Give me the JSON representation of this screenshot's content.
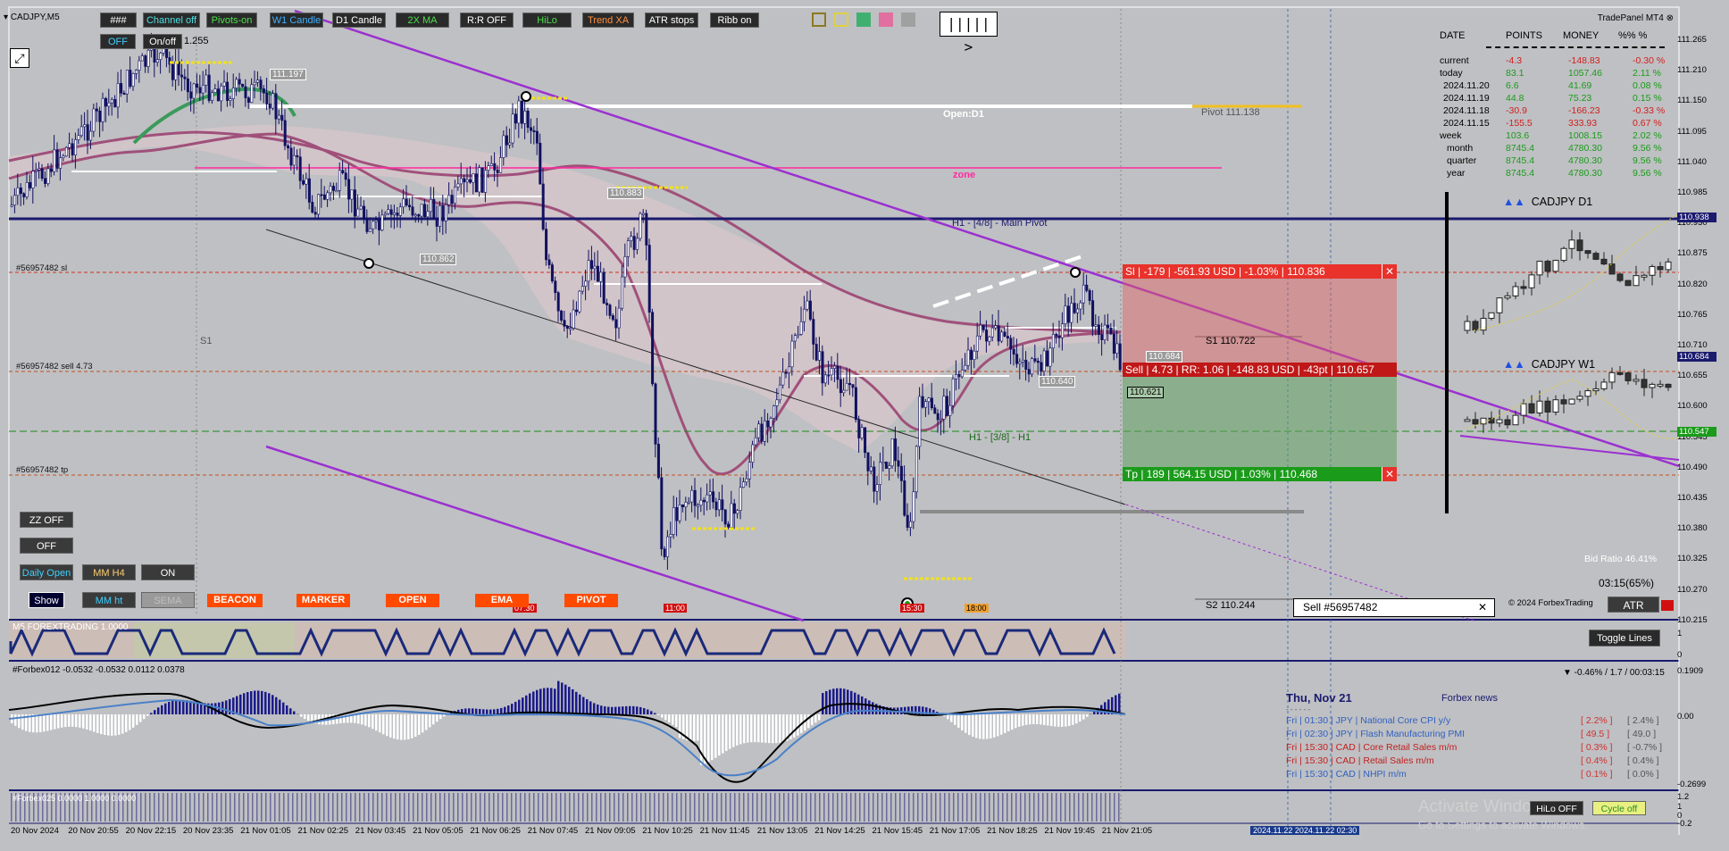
{
  "symbol": "CADJPY,M5",
  "toolbar": {
    "row1": [
      "###",
      "Channel off",
      "Pivots-on",
      "W1 Candle",
      "D1 Candle",
      "2X MA",
      "R:R OFF",
      "HiLo",
      "Trend XA",
      "ATR stops",
      "Ribb on"
    ],
    "off_label": "OFF",
    "onoff_label": "On/off",
    "onoff_value": "1.255",
    "nav_label": "||||| >"
  },
  "colors": {
    "bg": "#bfc0c3",
    "sell_red": "#e8322b",
    "tp_green": "#1a9b1a",
    "navy": "#1a1a6e",
    "purple": "#9b30d0",
    "orange": "#ff4a00"
  },
  "chart_labels": {
    "open_d1": "Open:D1",
    "pivot": "Pivot 111.138",
    "zone": "zone",
    "main_pivot": "H1 - [4/8] - Main Pivot",
    "h1_38": "H1 - [3/8] - H1",
    "s1_pivot": "S1 110.722",
    "s2_pivot": "S2 110.244",
    "s1_left": "S1",
    "order_sl": "#56957482 sl",
    "order_sell": "#56957482 sell 4.73",
    "order_tp": "#56957482 tp",
    "price_tags": [
      "111.197",
      "110.862",
      "110.883",
      "110.640",
      "110.684",
      "110.621"
    ],
    "time_tags": [
      "07:30",
      "11:00",
      "15:30",
      "18:00"
    ],
    "indicator1": "M5 FOREXTRADING 1.0000",
    "indicator2": "#Forbex012 -0.0532 -0.0532 0.0112 0.0378",
    "indicator3": "#Forbex025 0.0000 1.0000 0.0000"
  },
  "trade": {
    "sl_bar": "Sl  |  -179  |  -561.93 USD  |  -1.03%  |  110.836",
    "sell_bar": "Sell  |  4.73  |  RR: 1.06  |  -148.83 USD  |  -43pt  |  110.657",
    "tp_bar": "Tp  |  189  |  564.15 USD  |  1.03%  |  110.468",
    "close_x": "✕",
    "sell_box": "Sell  #56957482"
  },
  "left_buttons": {
    "zz_off": "ZZ OFF",
    "off": "OFF",
    "daily_open": "Daily Open",
    "mm_h4": "MM H4",
    "on": "ON",
    "show": "Show",
    "mm_ht": "MM ht",
    "sema": "SEMA",
    "tags": [
      "BEACON",
      "MARKER",
      "OPEN",
      "EMA",
      "PIVOT"
    ]
  },
  "trade_panel": {
    "title": "TradePanel MT4",
    "headers": [
      "DATE",
      "POINTS",
      "MONEY",
      "%%  %"
    ],
    "rows": [
      [
        "current",
        "-4.3",
        "-148.83",
        "-0.30 %"
      ],
      [
        "today",
        "83.1",
        "1057.46",
        "2.11 %"
      ],
      [
        "2024.11.20",
        "6.6",
        "41.69",
        "0.08 %"
      ],
      [
        "2024.11.19",
        "44.8",
        "75.23",
        "0.15 %"
      ],
      [
        "2024.11.18",
        "-30.9",
        "-166.23",
        "-0.33 %"
      ],
      [
        "2024.11.15",
        "-155.5",
        "333.93",
        "0.67 %"
      ],
      [
        "week",
        "103.6",
        "1008.15",
        "2.02 %"
      ],
      [
        "month",
        "8745.4",
        "4780.30",
        "9.56 %"
      ],
      [
        "quarter",
        "8745.4",
        "4780.30",
        "9.56 %"
      ],
      [
        "year",
        "8745.4",
        "4780.30",
        "9.56 %"
      ]
    ]
  },
  "mini_charts": {
    "d1": "CADJPY  D1",
    "w1": "CADJPY  W1"
  },
  "right_info": {
    "bid_ratio": "Bid Ratio 46.41%",
    "timer": "03:15(65%)",
    "copyright": "© 2024 ForbexTrading",
    "atr_btn": "ATR",
    "toggle_lines": "Toggle Lines",
    "ind2_info": "▼ -0.46% / 1.7 / 00:03:15"
  },
  "news": {
    "date": "Thu, Nov 21",
    "title": "Forbex news",
    "items": [
      {
        "text": "Fri  |  01:30  |  JPY  |  National Core CPI y/y",
        "actual": "[ 2.2% ]",
        "prev": "[ 2.4% ]",
        "color": "#3060c0"
      },
      {
        "text": "Fri  |  02:30  |  JPY  |  Flash Manufacturing PMI",
        "actual": "[ 49.5 ]",
        "prev": "[ 49.0 ]",
        "color": "#3060c0"
      },
      {
        "text": "Fri  |  15:30  |  CAD  |  Core Retail Sales m/m",
        "actual": "[ 0.3% ]",
        "prev": "[ -0.7% ]",
        "color": "#c02020"
      },
      {
        "text": "Fri  |  15:30  |  CAD  |  Retail Sales m/m",
        "actual": "[ 0.4% ]",
        "prev": "[ 0.4% ]",
        "color": "#c02020"
      },
      {
        "text": "Fri  |  15:30  |  CAD  |  NHPI m/m",
        "actual": "[ 0.1% ]",
        "prev": "[ 0.0% ]",
        "color": "#3060c0"
      }
    ]
  },
  "bottom_buttons": {
    "hilo_off": "HiLo OFF",
    "cycle_off": "Cycle off"
  },
  "watermark": {
    "line1": "Activate Windows",
    "line2": "Go to Settings to activate Windows."
  },
  "price_axis": [
    "111.265",
    "111.210",
    "111.150",
    "111.095",
    "111.040",
    "110.985",
    "110.930",
    "110.875",
    "110.820",
    "110.765",
    "110.710",
    "110.655",
    "110.600",
    "110.545",
    "110.490",
    "110.435",
    "110.380",
    "110.325",
    "110.270",
    "110.215"
  ],
  "price_boxes": {
    "current1": "110.938",
    "current2": "110.684",
    "current3": "110.547"
  },
  "ind_axis1": [
    "1",
    "0"
  ],
  "ind_axis2": [
    "0.1909",
    "0.00",
    "-0.2699"
  ],
  "ind_axis3": [
    "1.2",
    "1",
    "0",
    "-0.2"
  ],
  "time_axis": [
    "20 Nov 2024",
    "20 Nov 20:55",
    "20 Nov 22:15",
    "20 Nov 23:35",
    "21 Nov 01:05",
    "21 Nov 02:25",
    "21 Nov 03:45",
    "21 Nov 05:05",
    "21 Nov 06:25",
    "21 Nov 07:45",
    "21 Nov 09:05",
    "21 Nov 10:25",
    "21 Nov 11:45",
    "21 Nov 13:05",
    "21 Nov 14:25",
    "21 Nov 15:45",
    "21 Nov 17:05",
    "21 Nov 18:25",
    "21 Nov 19:45",
    "21 Nov 21:05"
  ],
  "time_box": "2024.11.22  2024.11.22 02:30"
}
